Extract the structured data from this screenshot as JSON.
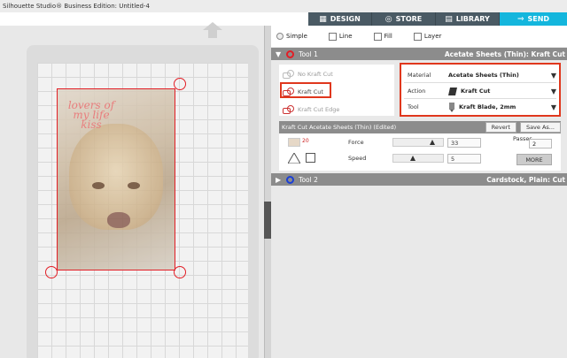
{
  "window": {
    "title": "Silhouette Studio® Business Edition: Untitled-4"
  },
  "tabs": [
    {
      "label": "DESIGN",
      "icon": "grid-icon"
    },
    {
      "label": "STORE",
      "icon": "store-icon"
    },
    {
      "label": "LIBRARY",
      "icon": "library-icon"
    },
    {
      "label": "SEND",
      "icon": "send-icon",
      "active": true
    }
  ],
  "canvas": {
    "lettering": "lovers of my life kiss",
    "cut_line_color": "#e21e26"
  },
  "modes": [
    {
      "label": "Simple",
      "icon": "radio-icon"
    },
    {
      "label": "Line",
      "icon": "line-mode-icon"
    },
    {
      "label": "Fill",
      "icon": "fill-mode-icon"
    },
    {
      "label": "Layer",
      "icon": "layer-mode-icon"
    }
  ],
  "tool1": {
    "label": "Tool 1",
    "summary": "Acetate Sheets (Thin): Kraft Cut",
    "color": "#e21e26"
  },
  "cut_options": [
    {
      "label": "No Kraft Cut",
      "active": false
    },
    {
      "label": "Kraft Cut",
      "active": true
    },
    {
      "label": "Kraft Cut Edge",
      "active": false
    }
  ],
  "material_settings": {
    "material_label": "Material",
    "material_value": "Acetate Sheets (Thin)",
    "action_label": "Action",
    "action_value": "Kraft Cut",
    "tool_label": "Tool",
    "tool_value": "Kraft Blade, 2mm"
  },
  "settings": {
    "header": "Kraft Cut Acetate Sheets (Thin) (Edited)",
    "revert_label": "Revert",
    "save_as_label": "Save As...",
    "force_label": "Force",
    "force_value": "33",
    "force_level": 0.78,
    "speed_label": "Speed",
    "speed_value": "5",
    "speed_level": 0.36,
    "passes_label": "Passes",
    "passes_value": "2",
    "more_label": "MORE",
    "swatch_num": "20"
  },
  "tool2": {
    "label": "Tool 2",
    "summary": "Cardstock, Plain: Cut",
    "color": "#1a3fd6"
  },
  "colors": {
    "accent": "#14b6dd",
    "highlight": "#e0371d"
  }
}
